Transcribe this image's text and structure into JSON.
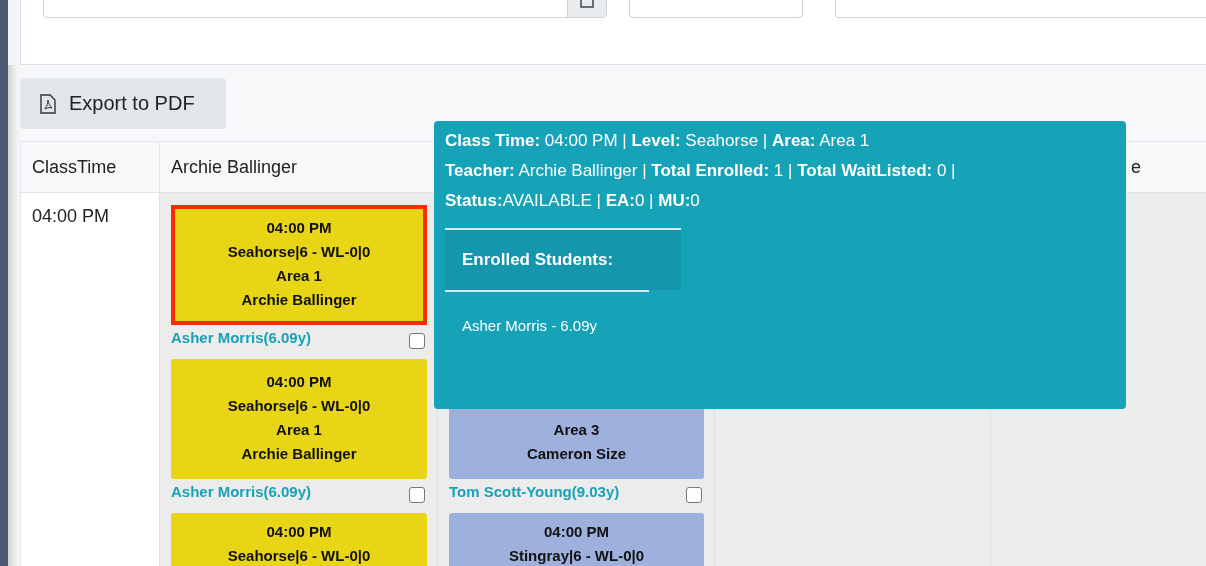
{
  "export_button": {
    "label": "Export to PDF"
  },
  "table": {
    "columns": [
      {
        "header": "ClassTime"
      },
      {
        "header": "Archie Ballinger"
      },
      {},
      {},
      {
        "header": "e"
      }
    ],
    "rows": [
      {
        "cells": [
          {
            "kind": "time",
            "text": "04:00 PM"
          },
          {
            "kind": "classes",
            "cards": [
              {
                "color": "#e8d516",
                "highlighted": true,
                "lines": [
                  "04:00 PM",
                  "Seahorse|6 - WL-0|0",
                  "Area 1",
                  "Archie Ballinger"
                ],
                "student": {
                  "label": "Asher Morris(6.09y)",
                  "checked": false
                }
              },
              {
                "color": "#e8d516",
                "highlighted": false,
                "lines": [
                  "04:00 PM",
                  "Seahorse|6 - WL-0|0",
                  "Area 1",
                  "Archie Ballinger"
                ],
                "student": {
                  "label": "Asher Morris(6.09y)",
                  "checked": false
                }
              },
              {
                "color": "#e8d516",
                "highlighted": false,
                "lines": [
                  "04:00 PM",
                  "Seahorse|6 - WL-0|0"
                ]
              }
            ]
          },
          {
            "kind": "classes",
            "cards": [
              {
                "color": "#9eb0dc",
                "highlighted": false,
                "lines": [
                  "Area 3",
                  "Cameron Size"
                ],
                "student": {
                  "label": "Tom Scott-Young(9.03y)",
                  "checked": false
                }
              },
              {
                "color": "#9eb0dc",
                "highlighted": false,
                "lines": [
                  "04:00 PM",
                  "Stingray|6 - WL-0|0"
                ]
              }
            ]
          },
          {
            "kind": "classes"
          },
          {
            "kind": "classes"
          }
        ]
      }
    ]
  },
  "tooltip": {
    "lines": [
      "**Class Time:** 04:00 PM | **Level:** Seahorse | **Area:** Area 1",
      "**Teacher:** Archie Ballinger | **Total Enrolled:** 1 | **Total WaitListed:** 0 |",
      "**Status:**AVAILABLE | **EA:**0 | **MU:**0"
    ],
    "enrolled_heading": "Enrolled Students:",
    "students": [
      "Asher Morris - 6.09y"
    ]
  }
}
